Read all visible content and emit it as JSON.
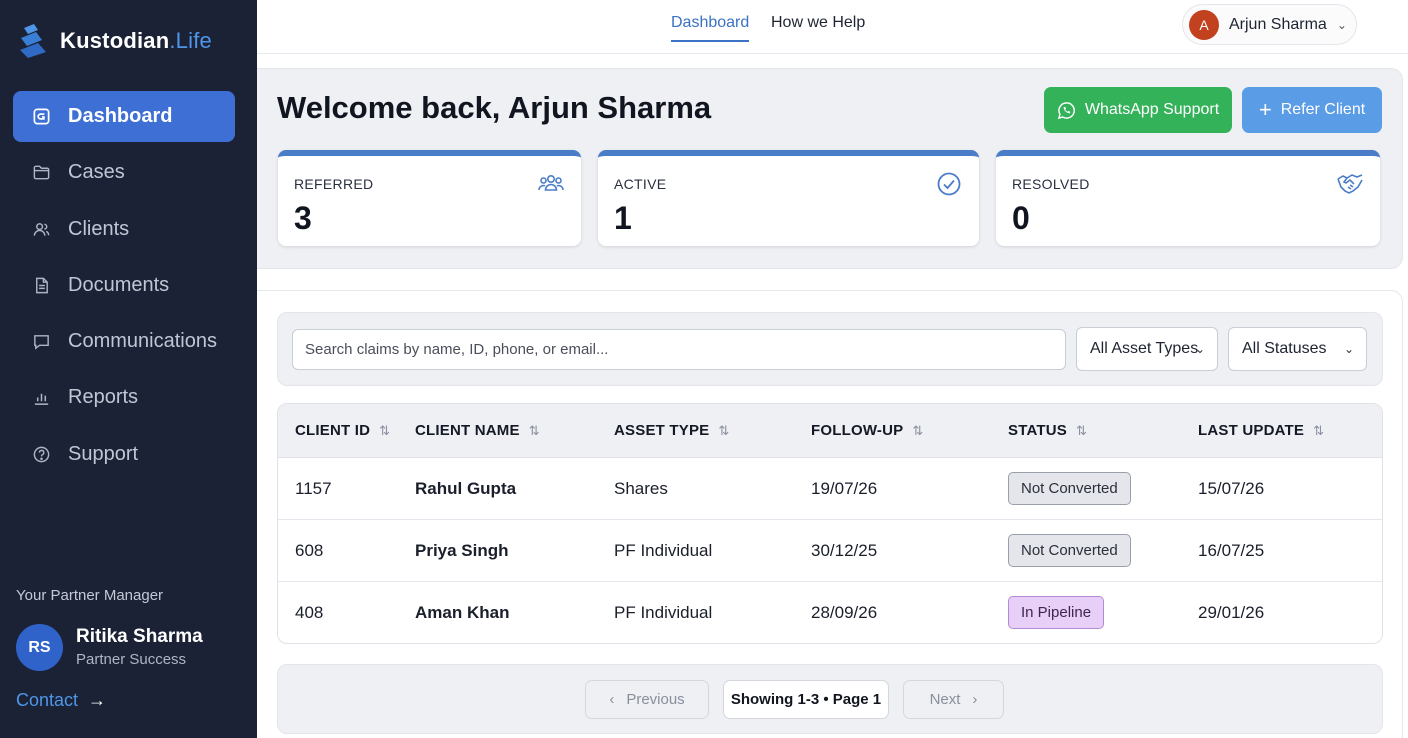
{
  "brand": {
    "name": "Kustodian",
    "suffix": ".Life"
  },
  "sidebar": {
    "items": [
      {
        "label": "Dashboard",
        "icon": "dashboard-icon",
        "active": true
      },
      {
        "label": "Cases",
        "icon": "folder-icon"
      },
      {
        "label": "Clients",
        "icon": "users-icon"
      },
      {
        "label": "Documents",
        "icon": "document-icon"
      },
      {
        "label": "Communications",
        "icon": "chat-icon"
      },
      {
        "label": "Reports",
        "icon": "bar-chart-icon"
      },
      {
        "label": "Support",
        "icon": "help-icon"
      }
    ],
    "partner_manager": {
      "label": "Your Partner Manager",
      "initials": "RS",
      "name": "Ritika Sharma",
      "role": "Partner Success",
      "contact_label": "Contact"
    }
  },
  "topnav": {
    "links": [
      {
        "label": "Dashboard",
        "active": true
      },
      {
        "label": "How we Help"
      }
    ],
    "user": {
      "initial": "A",
      "name": "Arjun Sharma"
    }
  },
  "welcome": {
    "title": "Welcome back, Arjun Sharma",
    "whatsapp_label": "WhatsApp Support",
    "refer_label": "Refer Client"
  },
  "stats": [
    {
      "label": "REFERRED",
      "value": "3",
      "icon": "users-group-icon"
    },
    {
      "label": "ACTIVE",
      "value": "1",
      "icon": "check-circle-icon"
    },
    {
      "label": "RESOLVED",
      "value": "0",
      "icon": "handshake-icon"
    }
  ],
  "filters": {
    "search_placeholder": "Search claims by name, ID, phone, or email...",
    "asset_type": "All Asset Types",
    "status": "All Statuses"
  },
  "table": {
    "columns": [
      "CLIENT ID",
      "CLIENT NAME",
      "ASSET TYPE",
      "FOLLOW-UP",
      "STATUS",
      "LAST UPDATE"
    ],
    "rows": [
      {
        "id": "1157",
        "name": "Rahul Gupta",
        "asset": "Shares",
        "followup": "19/07/26",
        "status": "Not Converted",
        "updated": "15/07/26"
      },
      {
        "id": "608",
        "name": "Priya Singh",
        "asset": "PF Individual",
        "followup": "30/12/25",
        "status": "Not Converted",
        "updated": "16/07/25"
      },
      {
        "id": "408",
        "name": "Aman Khan",
        "asset": "PF Individual",
        "followup": "28/09/26",
        "status": "In Pipeline",
        "updated": "29/01/26"
      }
    ]
  },
  "pagination": {
    "previous": "Previous",
    "info": "Showing 1-3 • Page 1",
    "next": "Next"
  },
  "colors": {
    "sidebar_bg": "#1b2235",
    "accent": "#3d6fd4",
    "whatsapp": "#34b25a",
    "refer": "#5a9ce6",
    "status_pipeline": "#e7cff7",
    "status_not_converted": "#e4e6eb"
  }
}
